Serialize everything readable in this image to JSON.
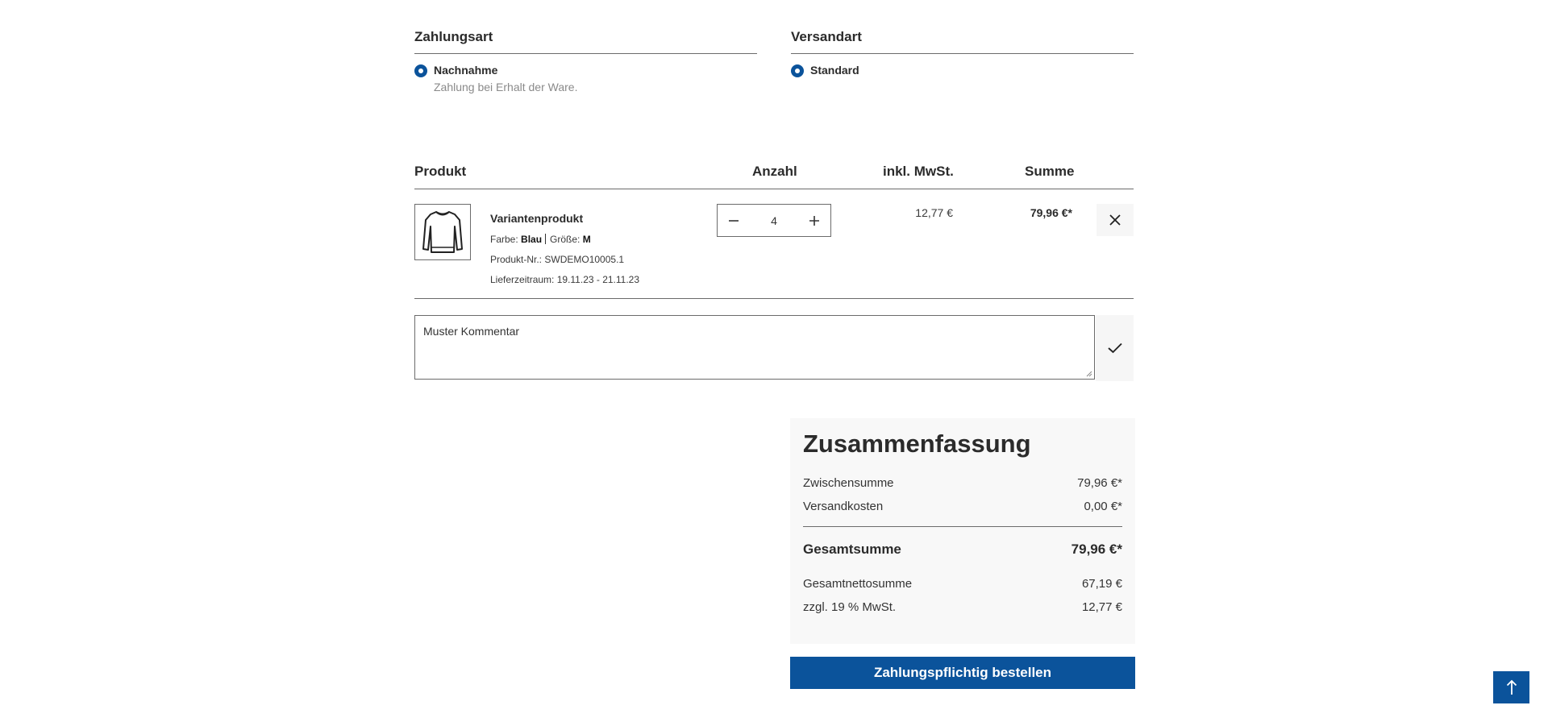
{
  "payment": {
    "title": "Zahlungsart",
    "option_label": "Nachnahme",
    "option_desc": "Zahlung bei Erhalt der Ware."
  },
  "shipping": {
    "title": "Versandart",
    "option_label": "Standard"
  },
  "table": {
    "col_product": "Produkt",
    "col_qty": "Anzahl",
    "col_unit": "inkl. MwSt.",
    "col_sum": "Summe"
  },
  "item": {
    "name": "Variantenprodukt",
    "color_label": "Farbe:",
    "color_value": "Blau",
    "size_label": "Größe:",
    "size_value": "M",
    "number_label": "Produkt-Nr.:",
    "number_value": "SWDEMO10005.1",
    "delivery_label": "Lieferzeitraum:",
    "delivery_value": "19.11.23 - 21.11.23",
    "quantity": "4",
    "unit_price": "12,77 €",
    "total_price": "79,96 €*",
    "thumbnail_icon": "longsleeve-shirt-icon"
  },
  "comment": {
    "value": "Muster Kommentar"
  },
  "summary": {
    "title": "Zusammenfassung",
    "subtotal_label": "Zwischensumme",
    "subtotal_value": "79,96 €*",
    "shipping_label": "Versandkosten",
    "shipping_value": "0,00 €*",
    "total_label": "Gesamtsumme",
    "total_value": "79,96 €*",
    "net_label": "Gesamtnettosumme",
    "net_value": "67,19 €",
    "tax_label": "zzgl. 19 % MwSt.",
    "tax_value": "12,77 €"
  },
  "order_button": "Zahlungspflichtig bestellen",
  "colors": {
    "primary": "#0b539b",
    "panel": "#f8f8f8"
  }
}
